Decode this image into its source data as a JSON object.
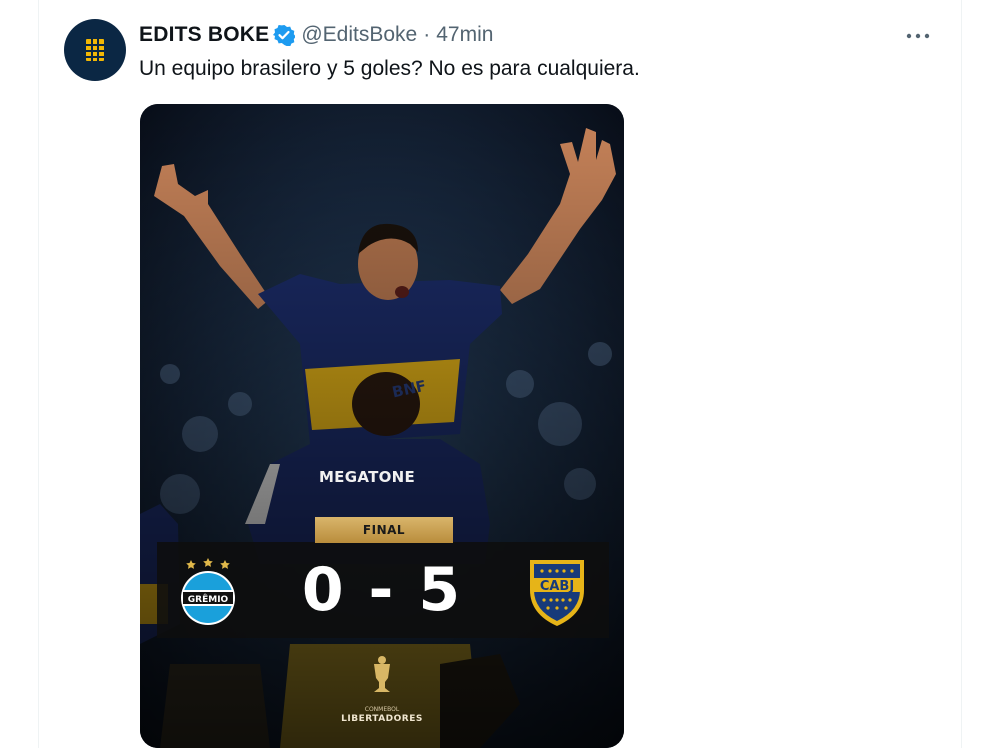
{
  "tweet": {
    "author_name": "EDITS BOKE",
    "handle": "@EditsBoke",
    "separator": "·",
    "time": "47min",
    "text": "Un equipo brasilero y 5 goles? No es para cualquiera.",
    "more_icon": "ellipsis-icon",
    "verified_icon": "verified-badge-icon"
  },
  "media": {
    "final_label": "FINAL",
    "score": "0 - 5",
    "home_team_badge_text": "GRÊMIO",
    "away_team_badge_text": "CABJ",
    "sponsor_text": "MEGATONE",
    "shirt_text": "BNF",
    "tournament_small": "CONMEBOL",
    "tournament": "LIBERTADORES"
  },
  "colors": {
    "verified_blue": "#1d9bf0",
    "boca_blue": "#0b2744",
    "boca_gold": "#f2b705",
    "gremio_blue": "#1aa0db"
  }
}
